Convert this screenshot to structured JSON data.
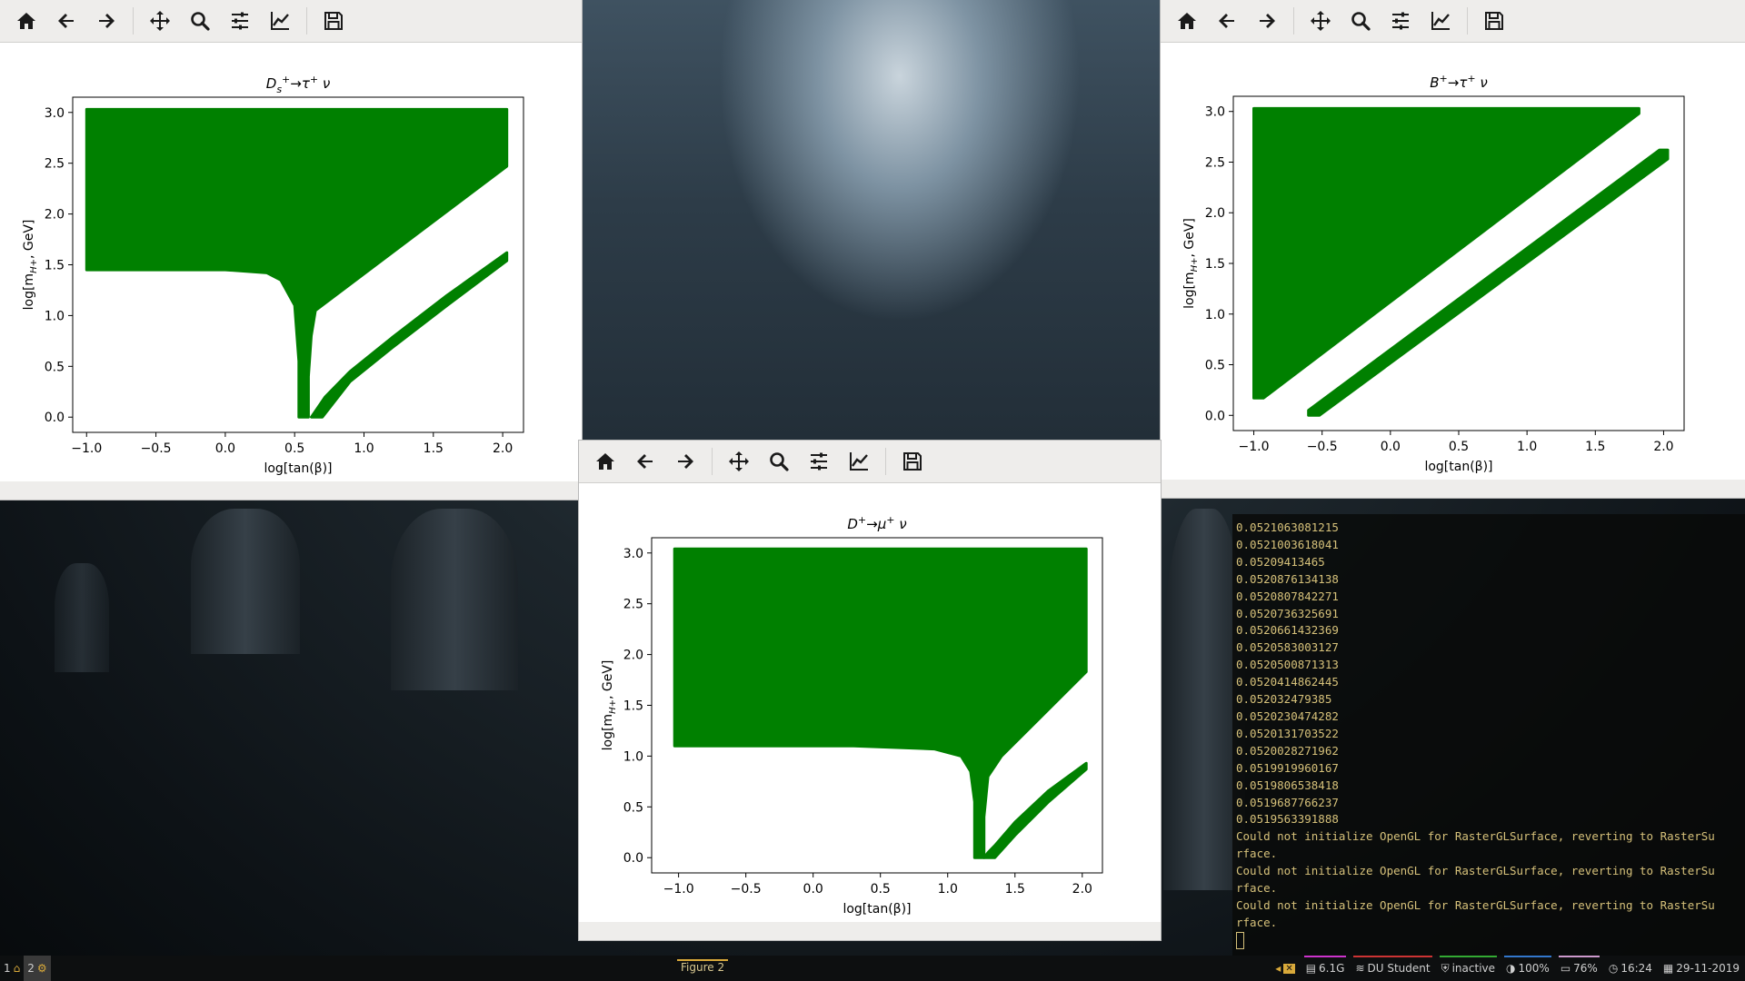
{
  "toolbar": {
    "buttons": [
      "home-icon",
      "back-icon",
      "forward-icon",
      "pan-icon",
      "zoom-icon",
      "configure-icon",
      "edit-axes-icon",
      "save-icon"
    ]
  },
  "figures": [
    {
      "chart_data": {
        "type": "area",
        "title": "D_s^+ → τ^+ ν",
        "title_parts": {
          "base": "D",
          "sub": "s",
          "sup": "+",
          "rest": "→τ",
          "sup2": "+",
          "end": "ν"
        },
        "xlabel": "log[tan(β)]",
        "ylabel": "log[m_H+, GeV]",
        "ylabel_parts": {
          "pre": "log[m",
          "sub": "H+",
          "post": ", GeV]"
        },
        "xlim": [
          -1.1,
          2.15
        ],
        "ylim": [
          -0.15,
          3.15
        ],
        "xticks": [
          "−1.0",
          "−0.5",
          "0.0",
          "0.5",
          "1.0",
          "1.5",
          "2.0"
        ],
        "xtick_values": [
          -1.0,
          -0.5,
          0.0,
          0.5,
          1.0,
          1.5,
          2.0
        ],
        "yticks": [
          "0.0",
          "0.5",
          "1.0",
          "1.5",
          "2.0",
          "2.5",
          "3.0"
        ],
        "ytick_values": [
          0.0,
          0.5,
          1.0,
          1.5,
          2.0,
          2.5,
          3.0
        ],
        "color": "#008000",
        "regions": [
          {
            "name": "",
            "points": [
              [
                -1.0,
                3.03
              ],
              [
                2.03,
                3.03
              ],
              [
                2.03,
                2.47
              ],
              [
                0.65,
                1.05
              ],
              [
                0.62,
                0.8
              ],
              [
                0.6,
                0.4
              ],
              [
                0.6,
                0.0
              ],
              [
                0.53,
                0.0
              ],
              [
                0.53,
                0.55
              ],
              [
                0.5,
                1.1
              ],
              [
                0.4,
                1.35
              ],
              [
                0.3,
                1.42
              ],
              [
                0.0,
                1.45
              ],
              [
                -1.0,
                1.45
              ]
            ]
          },
          {
            "name": "",
            "points": [
              [
                0.62,
                0.0
              ],
              [
                0.7,
                0.0
              ],
              [
                0.9,
                0.35
              ],
              [
                1.2,
                0.68
              ],
              [
                1.6,
                1.1
              ],
              [
                2.03,
                1.54
              ],
              [
                2.03,
                1.62
              ],
              [
                1.6,
                1.2
              ],
              [
                1.2,
                0.78
              ],
              [
                0.9,
                0.45
              ],
              [
                0.72,
                0.2
              ],
              [
                0.66,
                0.08
              ]
            ]
          }
        ],
        "grid": false
      }
    },
    {
      "chart_data": {
        "type": "area",
        "title": "B^+ → τ^+ ν",
        "title_parts": {
          "base": "B",
          "sub": "",
          "sup": "+",
          "rest": "→τ",
          "sup2": "+",
          "end": "ν"
        },
        "xlabel": "log[tan(β)]",
        "ylabel": "log[m_H+, GeV]",
        "ylabel_parts": {
          "pre": "log[m",
          "sub": "H+",
          "post": ", GeV]"
        },
        "xlim": [
          -1.15,
          2.15
        ],
        "ylim": [
          -0.15,
          3.15
        ],
        "xticks": [
          "−1.0",
          "−0.5",
          "0.0",
          "0.5",
          "1.0",
          "1.5",
          "2.0"
        ],
        "xtick_values": [
          -1.0,
          -0.5,
          0.0,
          0.5,
          1.0,
          1.5,
          2.0
        ],
        "yticks": [
          "0.0",
          "0.5",
          "1.0",
          "1.5",
          "2.0",
          "2.5",
          "3.0"
        ],
        "ytick_values": [
          0.0,
          0.5,
          1.0,
          1.5,
          2.0,
          2.5,
          3.0
        ],
        "color": "#008000",
        "regions": [
          {
            "name": "",
            "points": [
              [
                -1.0,
                3.03
              ],
              [
                1.82,
                3.03
              ],
              [
                1.82,
                2.98
              ],
              [
                -0.93,
                0.17
              ],
              [
                -1.0,
                0.17
              ]
            ]
          },
          {
            "name": "",
            "points": [
              [
                -0.6,
                0.0
              ],
              [
                -0.52,
                0.0
              ],
              [
                2.03,
                2.53
              ],
              [
                2.03,
                2.62
              ],
              [
                1.97,
                2.62
              ],
              [
                -0.6,
                0.05
              ]
            ]
          }
        ],
        "grid": false
      }
    },
    {
      "chart_data": {
        "type": "area",
        "title": "D^+ → μ^+ ν",
        "title_parts": {
          "base": "D",
          "sub": "",
          "sup": "+",
          "rest": "→μ",
          "sup2": "+",
          "end": "ν"
        },
        "xlabel": "log[tan(β)]",
        "ylabel": "log[m_H+, GeV]",
        "ylabel_parts": {
          "pre": "log[m",
          "sub": "H+",
          "post": ", GeV]"
        },
        "xlim": [
          -1.2,
          2.15
        ],
        "ylim": [
          -0.15,
          3.15
        ],
        "xticks": [
          "−1.0",
          "−0.5",
          "0.0",
          "0.5",
          "1.0",
          "1.5",
          "2.0"
        ],
        "xtick_values": [
          -1.0,
          -0.5,
          0.0,
          0.5,
          1.0,
          1.5,
          2.0
        ],
        "yticks": [
          "0.0",
          "0.5",
          "1.0",
          "1.5",
          "2.0",
          "2.5",
          "3.0"
        ],
        "ytick_values": [
          0.0,
          0.5,
          1.0,
          1.5,
          2.0,
          2.5,
          3.0
        ],
        "color": "#008000",
        "regions": [
          {
            "name": "",
            "points": [
              [
                -1.03,
                3.04
              ],
              [
                2.03,
                3.04
              ],
              [
                2.03,
                1.83
              ],
              [
                1.4,
                1.0
              ],
              [
                1.3,
                0.8
              ],
              [
                1.27,
                0.4
              ],
              [
                1.27,
                0.0
              ],
              [
                1.2,
                0.0
              ],
              [
                1.2,
                0.55
              ],
              [
                1.17,
                0.85
              ],
              [
                1.1,
                1.0
              ],
              [
                0.9,
                1.07
              ],
              [
                0.3,
                1.1
              ],
              [
                -1.03,
                1.1
              ]
            ]
          },
          {
            "name": "",
            "points": [
              [
                1.27,
                0.0
              ],
              [
                1.35,
                0.0
              ],
              [
                1.5,
                0.22
              ],
              [
                1.75,
                0.55
              ],
              [
                2.03,
                0.87
              ],
              [
                2.03,
                0.93
              ],
              [
                1.75,
                0.66
              ],
              [
                1.5,
                0.35
              ],
              [
                1.35,
                0.12
              ],
              [
                1.3,
                0.05
              ]
            ]
          }
        ],
        "grid": false
      }
    }
  ],
  "terminal": {
    "lines": [
      "0.0521063081215",
      "0.0521003618041",
      "0.05209413465",
      "0.0520876134138",
      "0.0520807842271",
      "0.0520736325691",
      "0.0520661432369",
      "0.0520583003127",
      "0.0520500871313",
      "0.0520414862445",
      "0.052032479385",
      "0.0520230474282",
      "0.0520131703522",
      "0.0520028271962",
      "0.0519919960167",
      "0.0519806538418",
      "0.0519687766237",
      "0.0519563391888",
      "Could not initialize OpenGL for RasterGLSurface, reverting to RasterSu",
      "rface.",
      "Could not initialize OpenGL for RasterGLSurface, reverting to RasterSu",
      "rface.",
      "Could not initialize OpenGL for RasterGLSurface, reverting to RasterSu",
      "rface."
    ]
  },
  "taskbar": {
    "workspace_1": "1",
    "workspace_2": "2",
    "active_window": "Figure 2",
    "disk": "6.1G",
    "network": "DU Student",
    "vpn": "inactive",
    "brightness": "100%",
    "battery": "76%",
    "time": "16:24",
    "date": "29-11-2019",
    "colors": {
      "net": "#c33",
      "vpn": "#3a3",
      "bright": "#37c",
      "battery": "#c9c",
      "disk": "#c3c"
    }
  }
}
